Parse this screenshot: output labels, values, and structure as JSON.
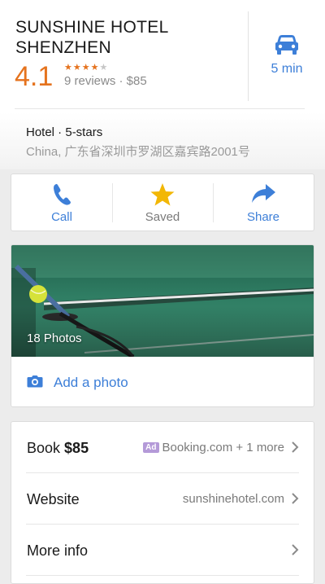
{
  "header": {
    "title": "SUNSHINE HOTEL SHENZHEN",
    "rating": "4.1",
    "stars": {
      "filled": 4,
      "total": 5
    },
    "reviews": "9 reviews · $85",
    "travel_time": "5 min",
    "travel_icon": "car-icon"
  },
  "info": {
    "type": "Hotel · 5-stars",
    "address": "China, 广东省深圳市罗湖区嘉宾路2001号"
  },
  "actions": [
    {
      "label": "Call",
      "icon": "phone-icon",
      "color": "#3d7fd8"
    },
    {
      "label": "Saved",
      "icon": "star-icon",
      "color": "#f2b705"
    },
    {
      "label": "Share",
      "icon": "share-arrow-icon",
      "color": "#3d7fd8"
    }
  ],
  "photos": {
    "count_label": "18 Photos",
    "add_label": "Add a photo"
  },
  "details": {
    "book": {
      "label": "Book",
      "price": "$85",
      "badge": "Ad",
      "provider": "Booking.com + 1 more"
    },
    "website": {
      "label": "Website",
      "value": "sunshinehotel.com"
    },
    "more": {
      "label": "More info"
    }
  },
  "colors": {
    "accent": "#3d7fd8",
    "rating": "#e5731e",
    "star": "#f2b705",
    "ad_badge": "#b49ad8"
  }
}
